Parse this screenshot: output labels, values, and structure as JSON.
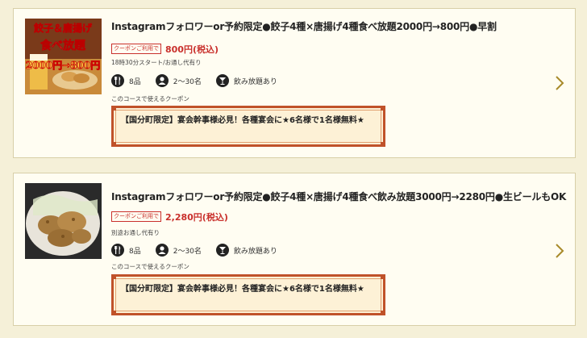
{
  "colors": {
    "accent": "#c9302c",
    "background": "#f5f0d8",
    "coupon_border": "#c0522a"
  },
  "courses": [
    {
      "title": "Instagramフォロワーor予約限定●餃子4種×唐揚げ4種食べ放題2000円→800円●早割",
      "coupon_tag": "クーポンご利用で",
      "price": "800円(税込)",
      "note": "18時30分スタート/お通し代有り",
      "items_count": "8品",
      "people": "2～30名",
      "drink": "飲み放題あり",
      "coupon_label": "このコースで使えるクーポン",
      "coupon_text": "【国分町限定】宴会幹事様必見！各種宴会に★6名様で1名様無料★",
      "thumb": {
        "line1": "餃子＆唐揚げ",
        "line2": "食べ放題",
        "line3": "2000円→800円"
      }
    },
    {
      "title": "Instagramフォロワーor予約限定●餃子4種×唐揚げ4種食べ飲み放題3000円→2280円●生ビールもOK",
      "coupon_tag": "クーポンご利用で",
      "price": "2,280円(税込)",
      "note": "別途お通し代有り",
      "items_count": "8品",
      "people": "2～30名",
      "drink": "飲み放題あり",
      "coupon_label": "このコースで使えるクーポン",
      "coupon_text": "【国分町限定】宴会幹事様必見！各種宴会に★6名様で1名様無料★"
    }
  ],
  "icons": {
    "food": "cutlery-icon",
    "people": "person-icon",
    "drink": "cocktail-icon",
    "next": "chevron-right-icon"
  }
}
